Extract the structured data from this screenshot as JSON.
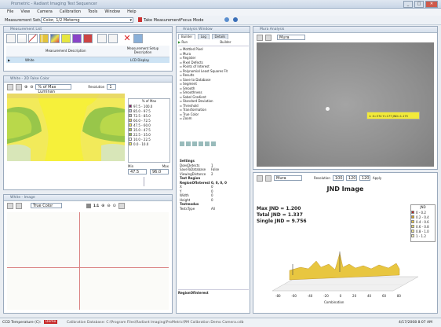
{
  "app": {
    "title": "Prometric - Radiant Imaging Test Sequencer"
  },
  "menu": [
    "File",
    "View",
    "Camera",
    "Calibration",
    "Tools",
    "Window",
    "Help"
  ],
  "toolbar": {
    "measurement_setup_label": "Measurement Setup",
    "measurement_setup_value": "Color, 1/2 Meterng",
    "take_measurement": "Take Measurement",
    "focus_mode": "Focus Mode"
  },
  "measurement_list": {
    "title": "Measurement List",
    "col_desc": "Measurement Description",
    "col_setup": "Measurement Setup Description",
    "row_desc": "White",
    "row_setup": "LCD Display"
  },
  "falsecolor_panel": {
    "title": "White - 2D False Color",
    "scale_label": "% of Max Luminan",
    "resolution_label": "Resolution",
    "resolution_value": "1",
    "legend_header": "% of Max",
    "legend": [
      {
        "label": "97.5 - 100.0",
        "color": "#8a1a6a"
      },
      {
        "label": "85.0 - 97.5",
        "color": "#cfcfe8"
      },
      {
        "label": "72.5 - 85.0",
        "color": "#c9c9c9"
      },
      {
        "label": "60.0 - 72.5",
        "color": "#e6d16b"
      },
      {
        "label": "47.5 - 60.0",
        "color": "#f2ea5a"
      },
      {
        "label": "35.0 - 47.5",
        "color": "#b9d84b"
      },
      {
        "label": "22.5 - 35.0",
        "color": "#98c64a"
      },
      {
        "label": "10.0 - 22.5",
        "color": "#ffffff"
      },
      {
        "label": "0.0 - 10.0",
        "color": "#f5f05a"
      }
    ],
    "min_label": "Min",
    "max_label": "Max",
    "min_value": "47.5",
    "max_value": "96.0"
  },
  "truecolor_panel": {
    "title": "White - Image",
    "mode": "True Color",
    "scale": "1:1"
  },
  "analysis_panel": {
    "title": "Analysis Window",
    "tabs": [
      "Builder",
      "Log",
      "Details"
    ],
    "run_label": "Run",
    "builder_label": "Builder",
    "tree": [
      "Mottled Pixel",
      "Mura",
      "Register",
      "Pixel Defects",
      "Points of Interest",
      "Polynomial Least Squares Fit",
      "Results",
      "Save to Database",
      "Segment",
      "Smooth",
      "Smoothness",
      "Sobel Gradient",
      "Standard Deviation",
      "Threshold",
      "Transformation",
      "True Color",
      "Zoom"
    ],
    "props": [
      {
        "k": "Settings",
        "v": "",
        "bold": true
      },
      {
        "k": "DoesDetects",
        "v": "1"
      },
      {
        "k": "SaveToDatabase",
        "v": "False"
      },
      {
        "k": "ViewingDistance",
        "v": "2"
      },
      {
        "k": "Test Region",
        "v": "",
        "bold": true
      },
      {
        "k": "RegionOfInterest",
        "v": "0, 0, 0, 0",
        "bold": true
      },
      {
        "k": "X",
        "v": "0"
      },
      {
        "k": "Y",
        "v": "0"
      },
      {
        "k": "Width",
        "v": "0"
      },
      {
        "k": "Height",
        "v": "0"
      },
      {
        "k": "Testmodus",
        "v": "",
        "bold": true
      },
      {
        "k": "TestsType",
        "v": "All"
      }
    ],
    "footer": "RegionOfInterest"
  },
  "mura_panel": {
    "title": "Mura Analysis",
    "mode": "Mura",
    "annotation": "1: X=374 Y=177 JND=1.175"
  },
  "jnd_panel": {
    "mode": "Mura",
    "resolution_label": "Resolution",
    "resolution_value": "100",
    "value_box_1": "120",
    "value_box_2": "120",
    "apply": "Apply",
    "title": "JND Image",
    "max_jnd": "Max JND = 1.200",
    "total_jnd": "Total JND = 1.337",
    "single_jnd": "Single JND = 9.756",
    "x_ticks": [
      "-80",
      "-60",
      "-40",
      "-20",
      "0",
      "20",
      "40",
      "60",
      "80"
    ],
    "x_label": "Combination",
    "legend_header": "JND",
    "legend": [
      {
        "label": "0 - 0.2",
        "color": "#b22222"
      },
      {
        "label": "0.2 - 0.4",
        "color": "#d4a017"
      },
      {
        "label": "0.4 - 0.6",
        "color": "#e8c640"
      },
      {
        "label": "0.6 - 0.8",
        "color": "#f0d96a"
      },
      {
        "label": "0.8 - 1.0",
        "color": "#f4e58f"
      },
      {
        "label": "1 - 1.2",
        "color": "#f7efb5"
      }
    ]
  },
  "status": {
    "ccd_label": "CCD Temperature (C):",
    "ccd_value": "Demo",
    "calibration": "Calibration Database: C:\\Program Files\\Radiant Imaging\\ProMetric\\PM Calibration Demo Camera.cdb",
    "datetime": "4/17/2008 8:07 AM"
  }
}
